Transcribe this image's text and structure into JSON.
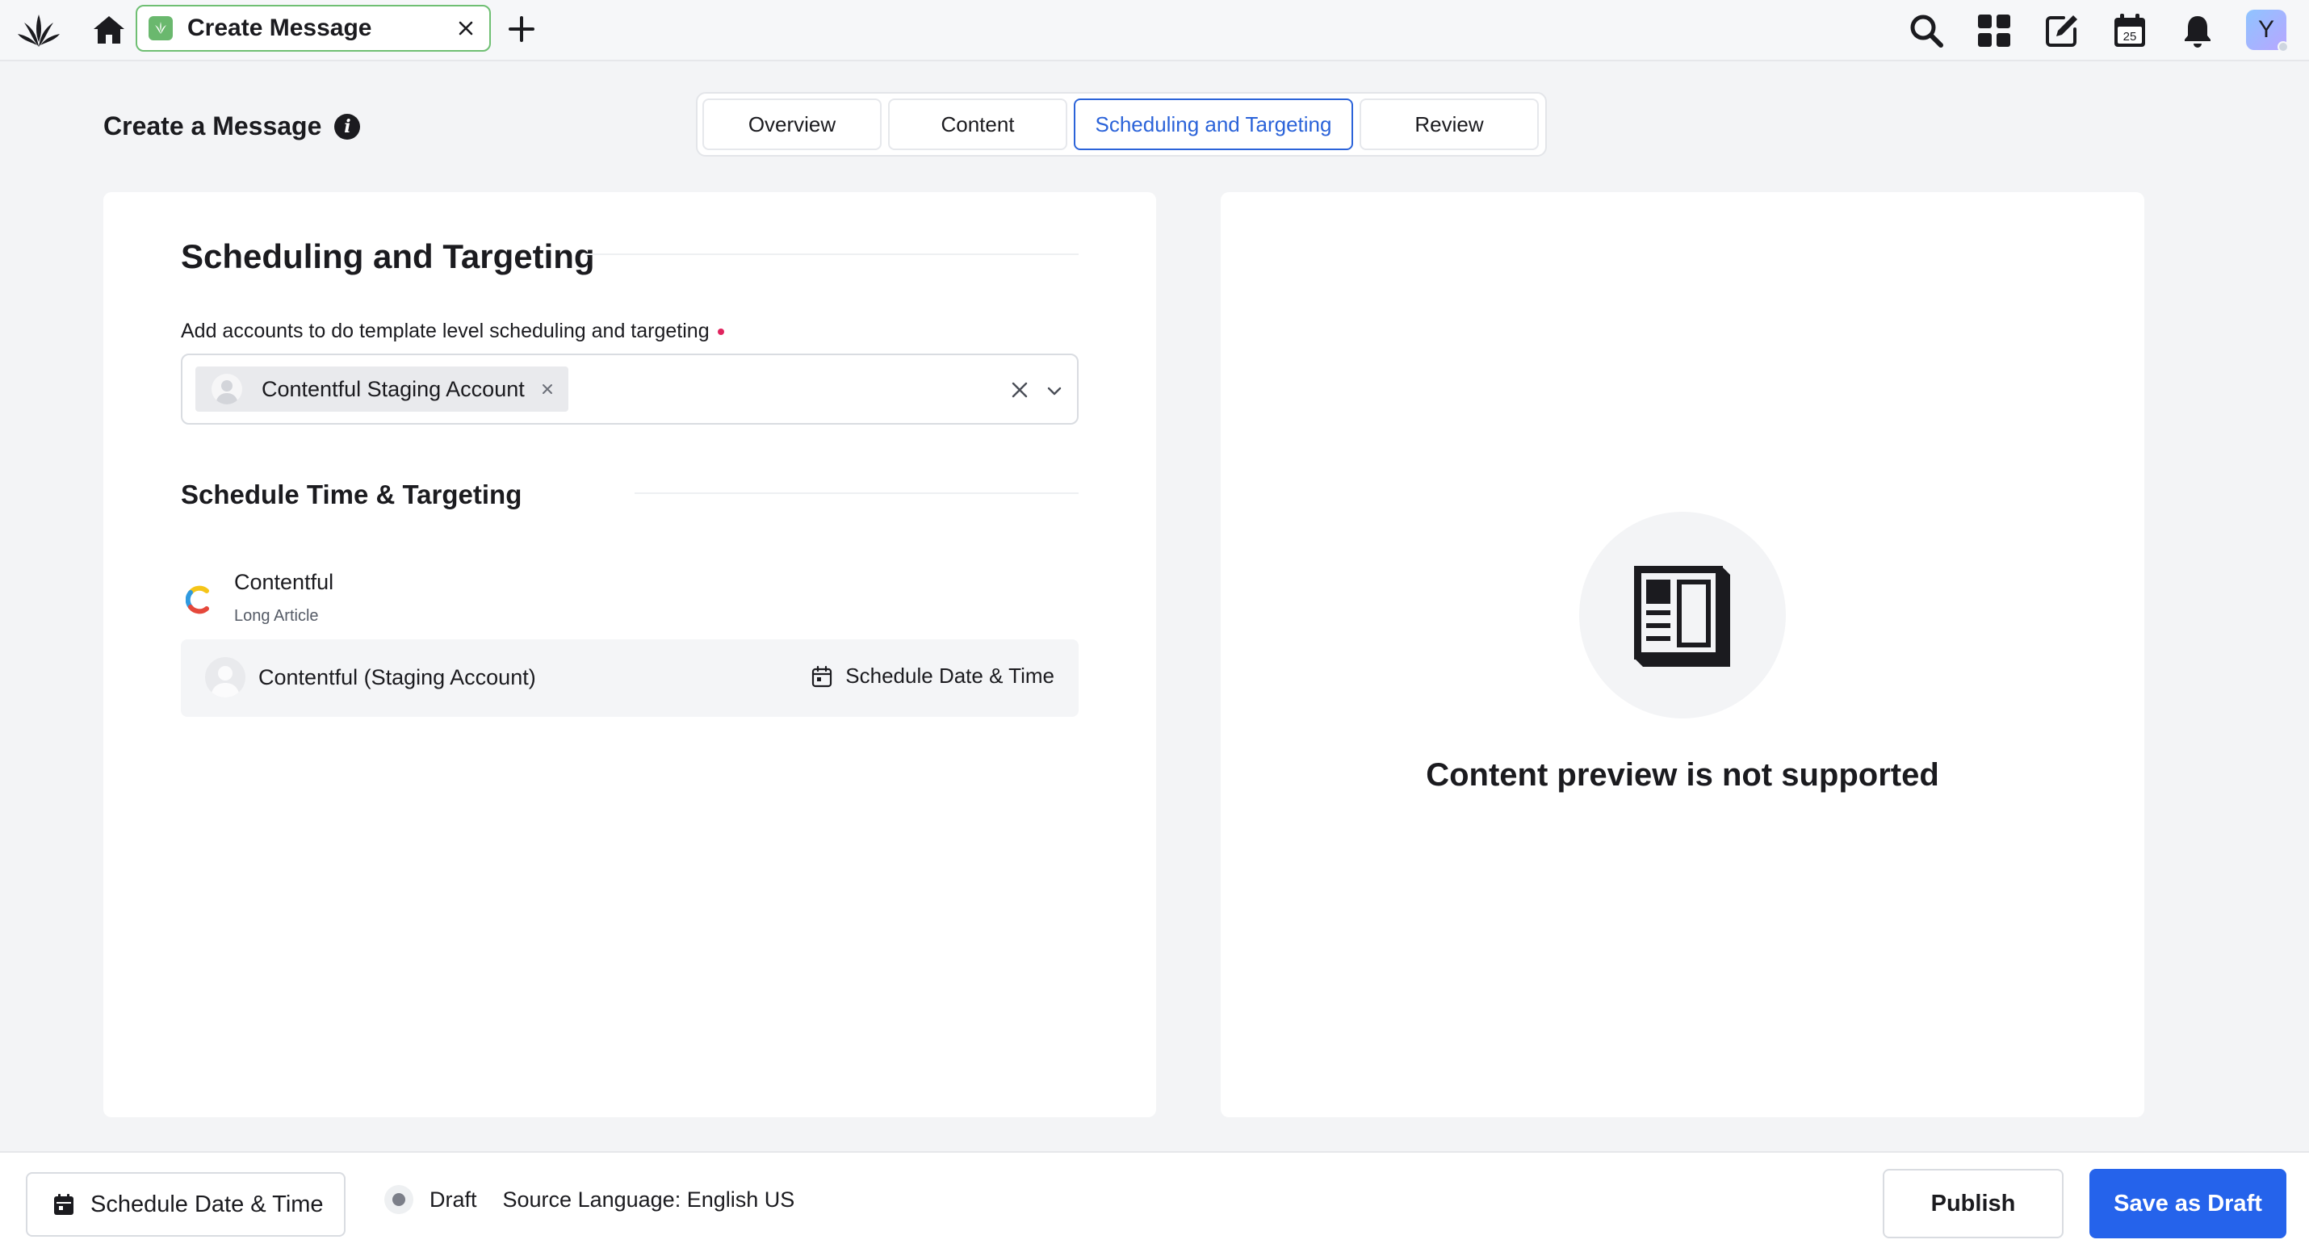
{
  "topbar": {
    "tab_label": "Create Message",
    "icons": [
      "brand-logo",
      "home-icon",
      "close-icon",
      "plus-icon",
      "search-icon",
      "grid-icon",
      "compose-icon",
      "calendar-icon",
      "bell-icon"
    ],
    "calendar_day": "25",
    "user_initial": "Y"
  },
  "header": {
    "title": "Create a Message",
    "steps": [
      "Overview",
      "Content",
      "Scheduling and Targeting",
      "Review"
    ],
    "active_step": "Scheduling and Targeting"
  },
  "left": {
    "section_title": "Scheduling and Targeting",
    "accounts_label": "Add accounts to do template level scheduling and targeting",
    "selected_account": "Contentful Staging Account",
    "sub_title": "Schedule Time & Targeting",
    "app_name": "Contentful",
    "app_type": "Long Article",
    "account_row_name": "Contentful (Staging Account)",
    "account_row_action": "Schedule Date & Time"
  },
  "right": {
    "preview_message": "Content preview is not supported"
  },
  "bottom": {
    "schedule_label": "Schedule Date & Time",
    "status": "Draft",
    "source_language": "Source Language: English US",
    "publish_label": "Publish",
    "draft_label": "Save as Draft"
  },
  "colors": {
    "accent": "#2563eb",
    "tab_border": "#6fbf73",
    "required": "#e0245e"
  }
}
